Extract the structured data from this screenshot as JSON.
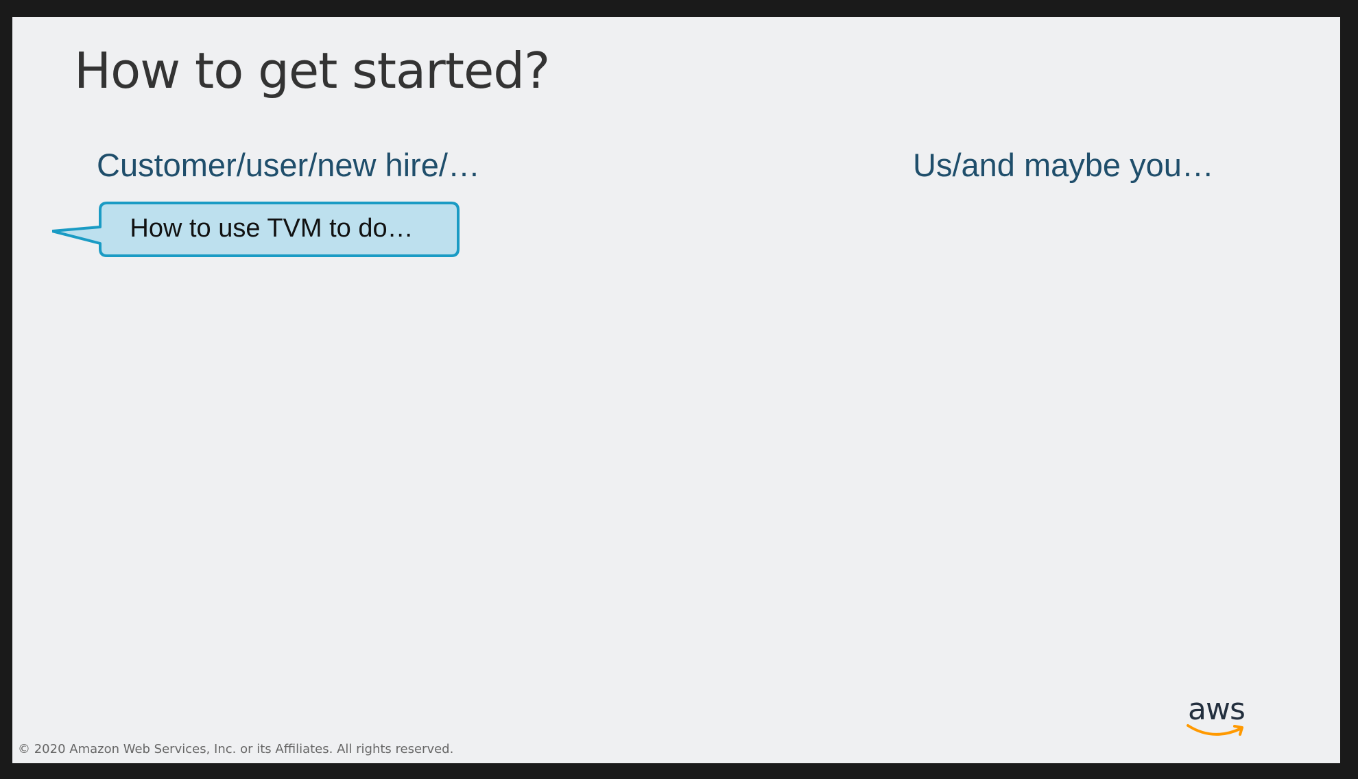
{
  "slide": {
    "title": "How to get started?",
    "left_heading": "Customer/user/new hire/…",
    "right_heading": "Us/and maybe you…",
    "callout_text": "How to use TVM to do…",
    "logo_text": "aws",
    "copyright": "© 2020 Amazon Web Services, Inc. or its Affiliates. All rights reserved."
  },
  "colors": {
    "background": "#eff0f2",
    "frame": "#1a1a1a",
    "title": "#333333",
    "heading": "#1f4e6b",
    "callout_fill": "#bde0ee",
    "callout_border": "#1a9bc4",
    "logo_smile": "#ff9900"
  },
  "icons": {
    "callout": "speech-bubble-callout",
    "logo": "aws-logo"
  }
}
